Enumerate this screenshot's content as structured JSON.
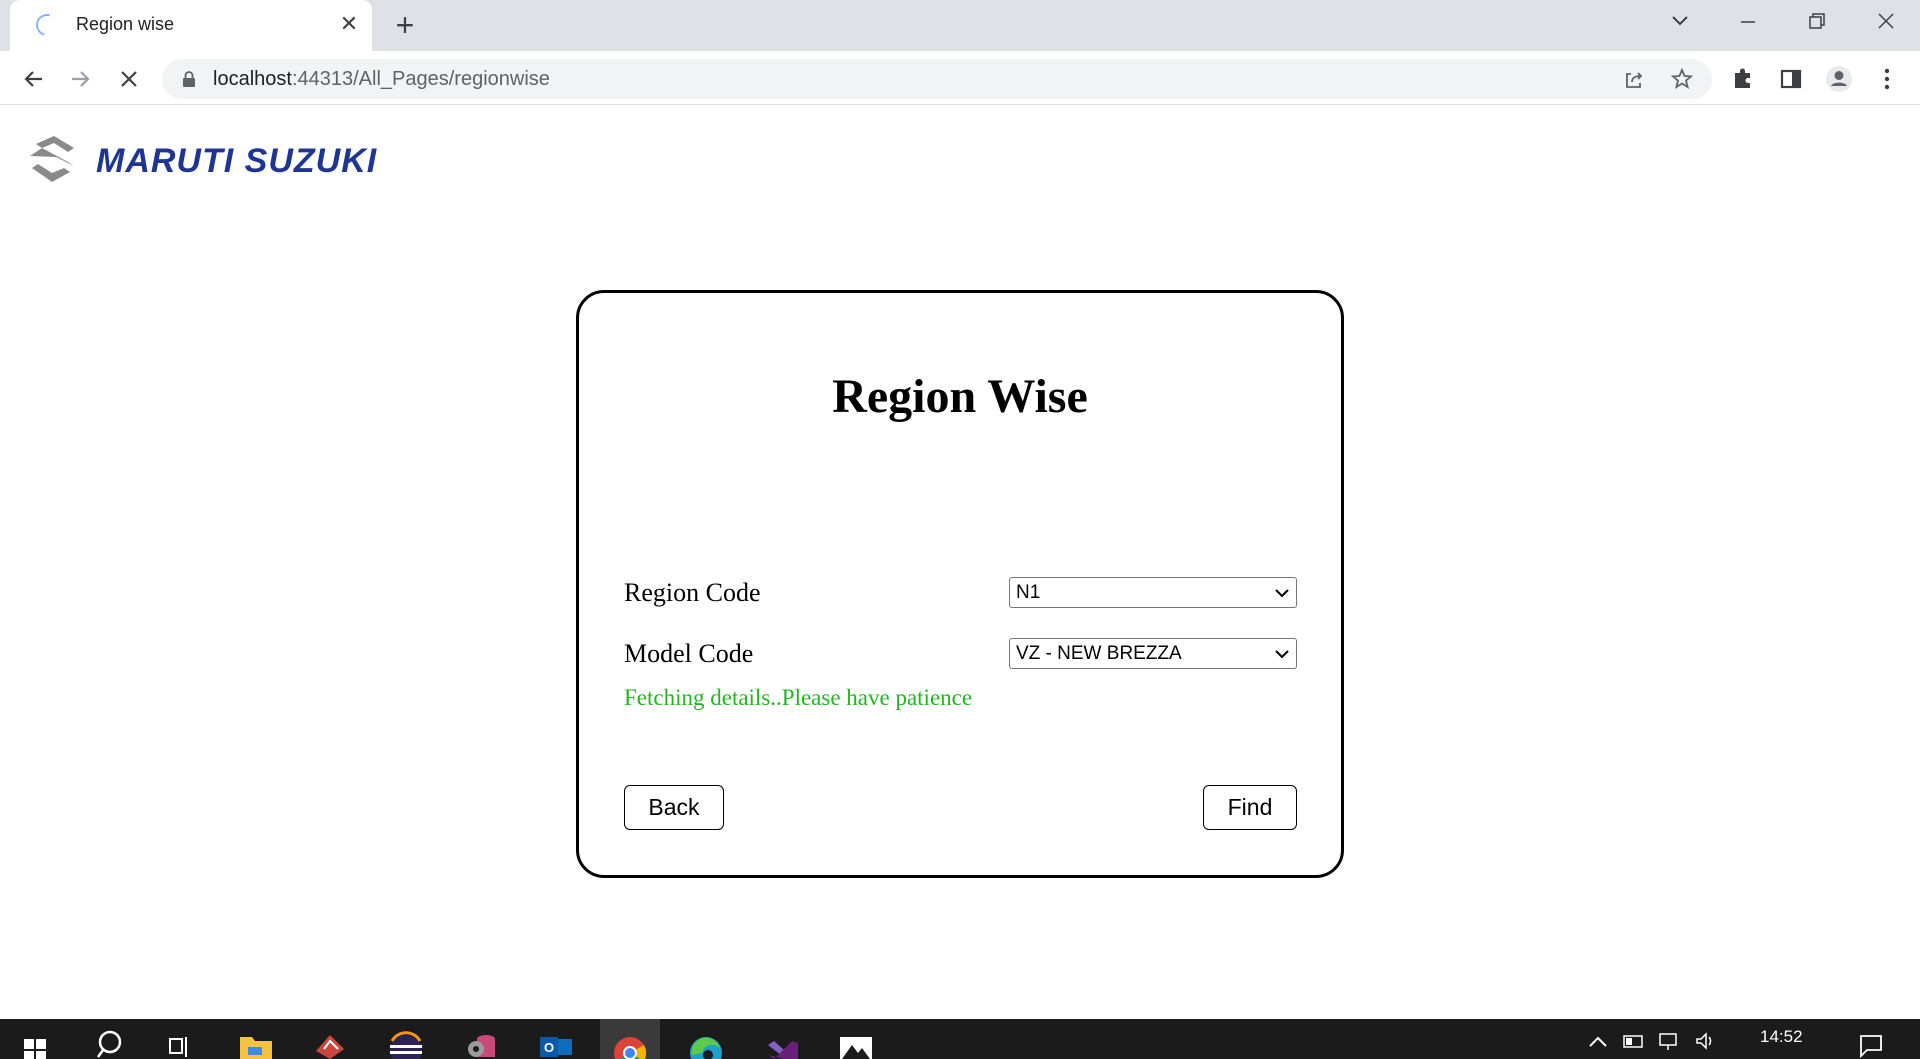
{
  "browser": {
    "tab_title": "Region wise",
    "url_host": "localhost",
    "url_path": ":44313/All_Pages/regionwise"
  },
  "header": {
    "logo_text": "MARUTI SUZUKI",
    "brand_color": "#1f3593"
  },
  "form": {
    "title": "Region Wise",
    "region_label": "Region Code",
    "region_value": "N1",
    "model_label": "Model Code",
    "model_value": "VZ - NEW BREZZA",
    "status_message": "Fetching details..Please have patience",
    "status_color": "#22b522",
    "back_label": "Back",
    "find_label": "Find"
  },
  "taskbar": {
    "time": "14:52",
    "apps": [
      "start-icon",
      "search-icon",
      "task-view-icon",
      "file-explorer-icon",
      "app-icon",
      "eclipse-icon",
      "database-icon",
      "outlook-icon",
      "chrome-icon",
      "edge-icon",
      "visual-studio-icon",
      "photos-icon"
    ]
  }
}
